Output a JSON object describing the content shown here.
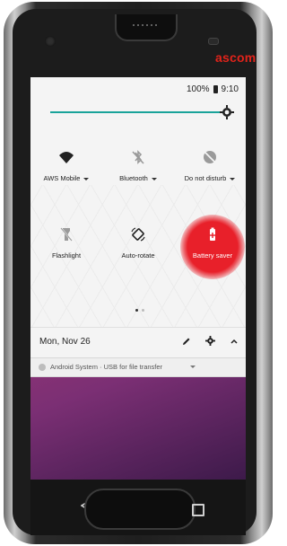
{
  "device": {
    "brand_logo": "ascom",
    "brand_color": "#e2231a"
  },
  "status_bar": {
    "battery": "100%",
    "time": "9:10"
  },
  "brightness": {
    "level": 0.95,
    "accent": "#1aa39a"
  },
  "tiles": [
    {
      "label": "AWS Mobile",
      "icon": "wifi-icon",
      "has_dropdown": true
    },
    {
      "label": "Bluetooth",
      "icon": "bluetooth-off-icon",
      "has_dropdown": true
    },
    {
      "label": "Do not disturb",
      "icon": "dnd-off-icon",
      "has_dropdown": true
    },
    {
      "label": "Flashlight",
      "icon": "flashlight-off-icon",
      "has_dropdown": false
    },
    {
      "label": "Auto-rotate",
      "icon": "auto-rotate-icon",
      "has_dropdown": false
    },
    {
      "label": "Battery saver",
      "icon": "battery-saver-icon",
      "has_dropdown": false,
      "highlighted": true
    }
  ],
  "pager": {
    "current": 1,
    "total": 2
  },
  "footer": {
    "date": "Mon, Nov 26"
  },
  "notification": {
    "text": "Android System · USB for file transfer"
  }
}
